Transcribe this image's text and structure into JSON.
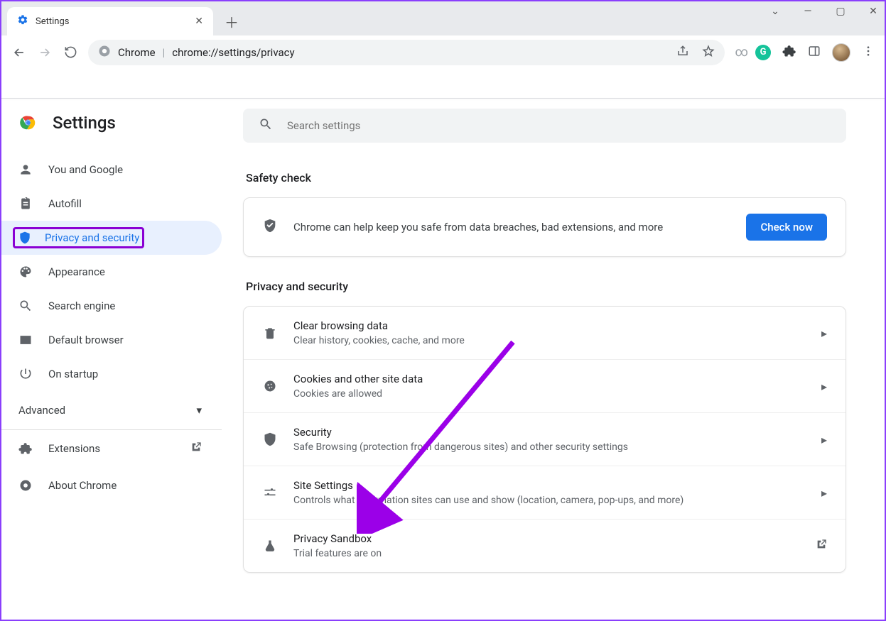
{
  "window": {
    "tab_title": "Settings",
    "url_prefix": "Chrome",
    "url": "chrome://settings/privacy"
  },
  "settings_header": {
    "title": "Settings",
    "search_placeholder": "Search settings"
  },
  "sidebar": {
    "items": [
      {
        "label": "You and Google"
      },
      {
        "label": "Autofill"
      },
      {
        "label": "Privacy and security"
      },
      {
        "label": "Appearance"
      },
      {
        "label": "Search engine"
      },
      {
        "label": "Default browser"
      },
      {
        "label": "On startup"
      }
    ],
    "advanced_label": "Advanced",
    "footer": {
      "extensions_label": "Extensions",
      "about_label": "About Chrome"
    }
  },
  "safety": {
    "section_title": "Safety check",
    "text": "Chrome can help keep you safe from data breaches, bad extensions, and more",
    "button": "Check now"
  },
  "privacy": {
    "section_title": "Privacy and security",
    "items": [
      {
        "title": "Clear browsing data",
        "sub": "Clear history, cookies, cache, and more"
      },
      {
        "title": "Cookies and other site data",
        "sub": "Cookies are allowed"
      },
      {
        "title": "Security",
        "sub": "Safe Browsing (protection from dangerous sites) and other security settings"
      },
      {
        "title": "Site Settings",
        "sub": "Controls what information sites can use and show (location, camera, pop-ups, and more)"
      },
      {
        "title": "Privacy Sandbox",
        "sub": "Trial features are on"
      }
    ]
  }
}
